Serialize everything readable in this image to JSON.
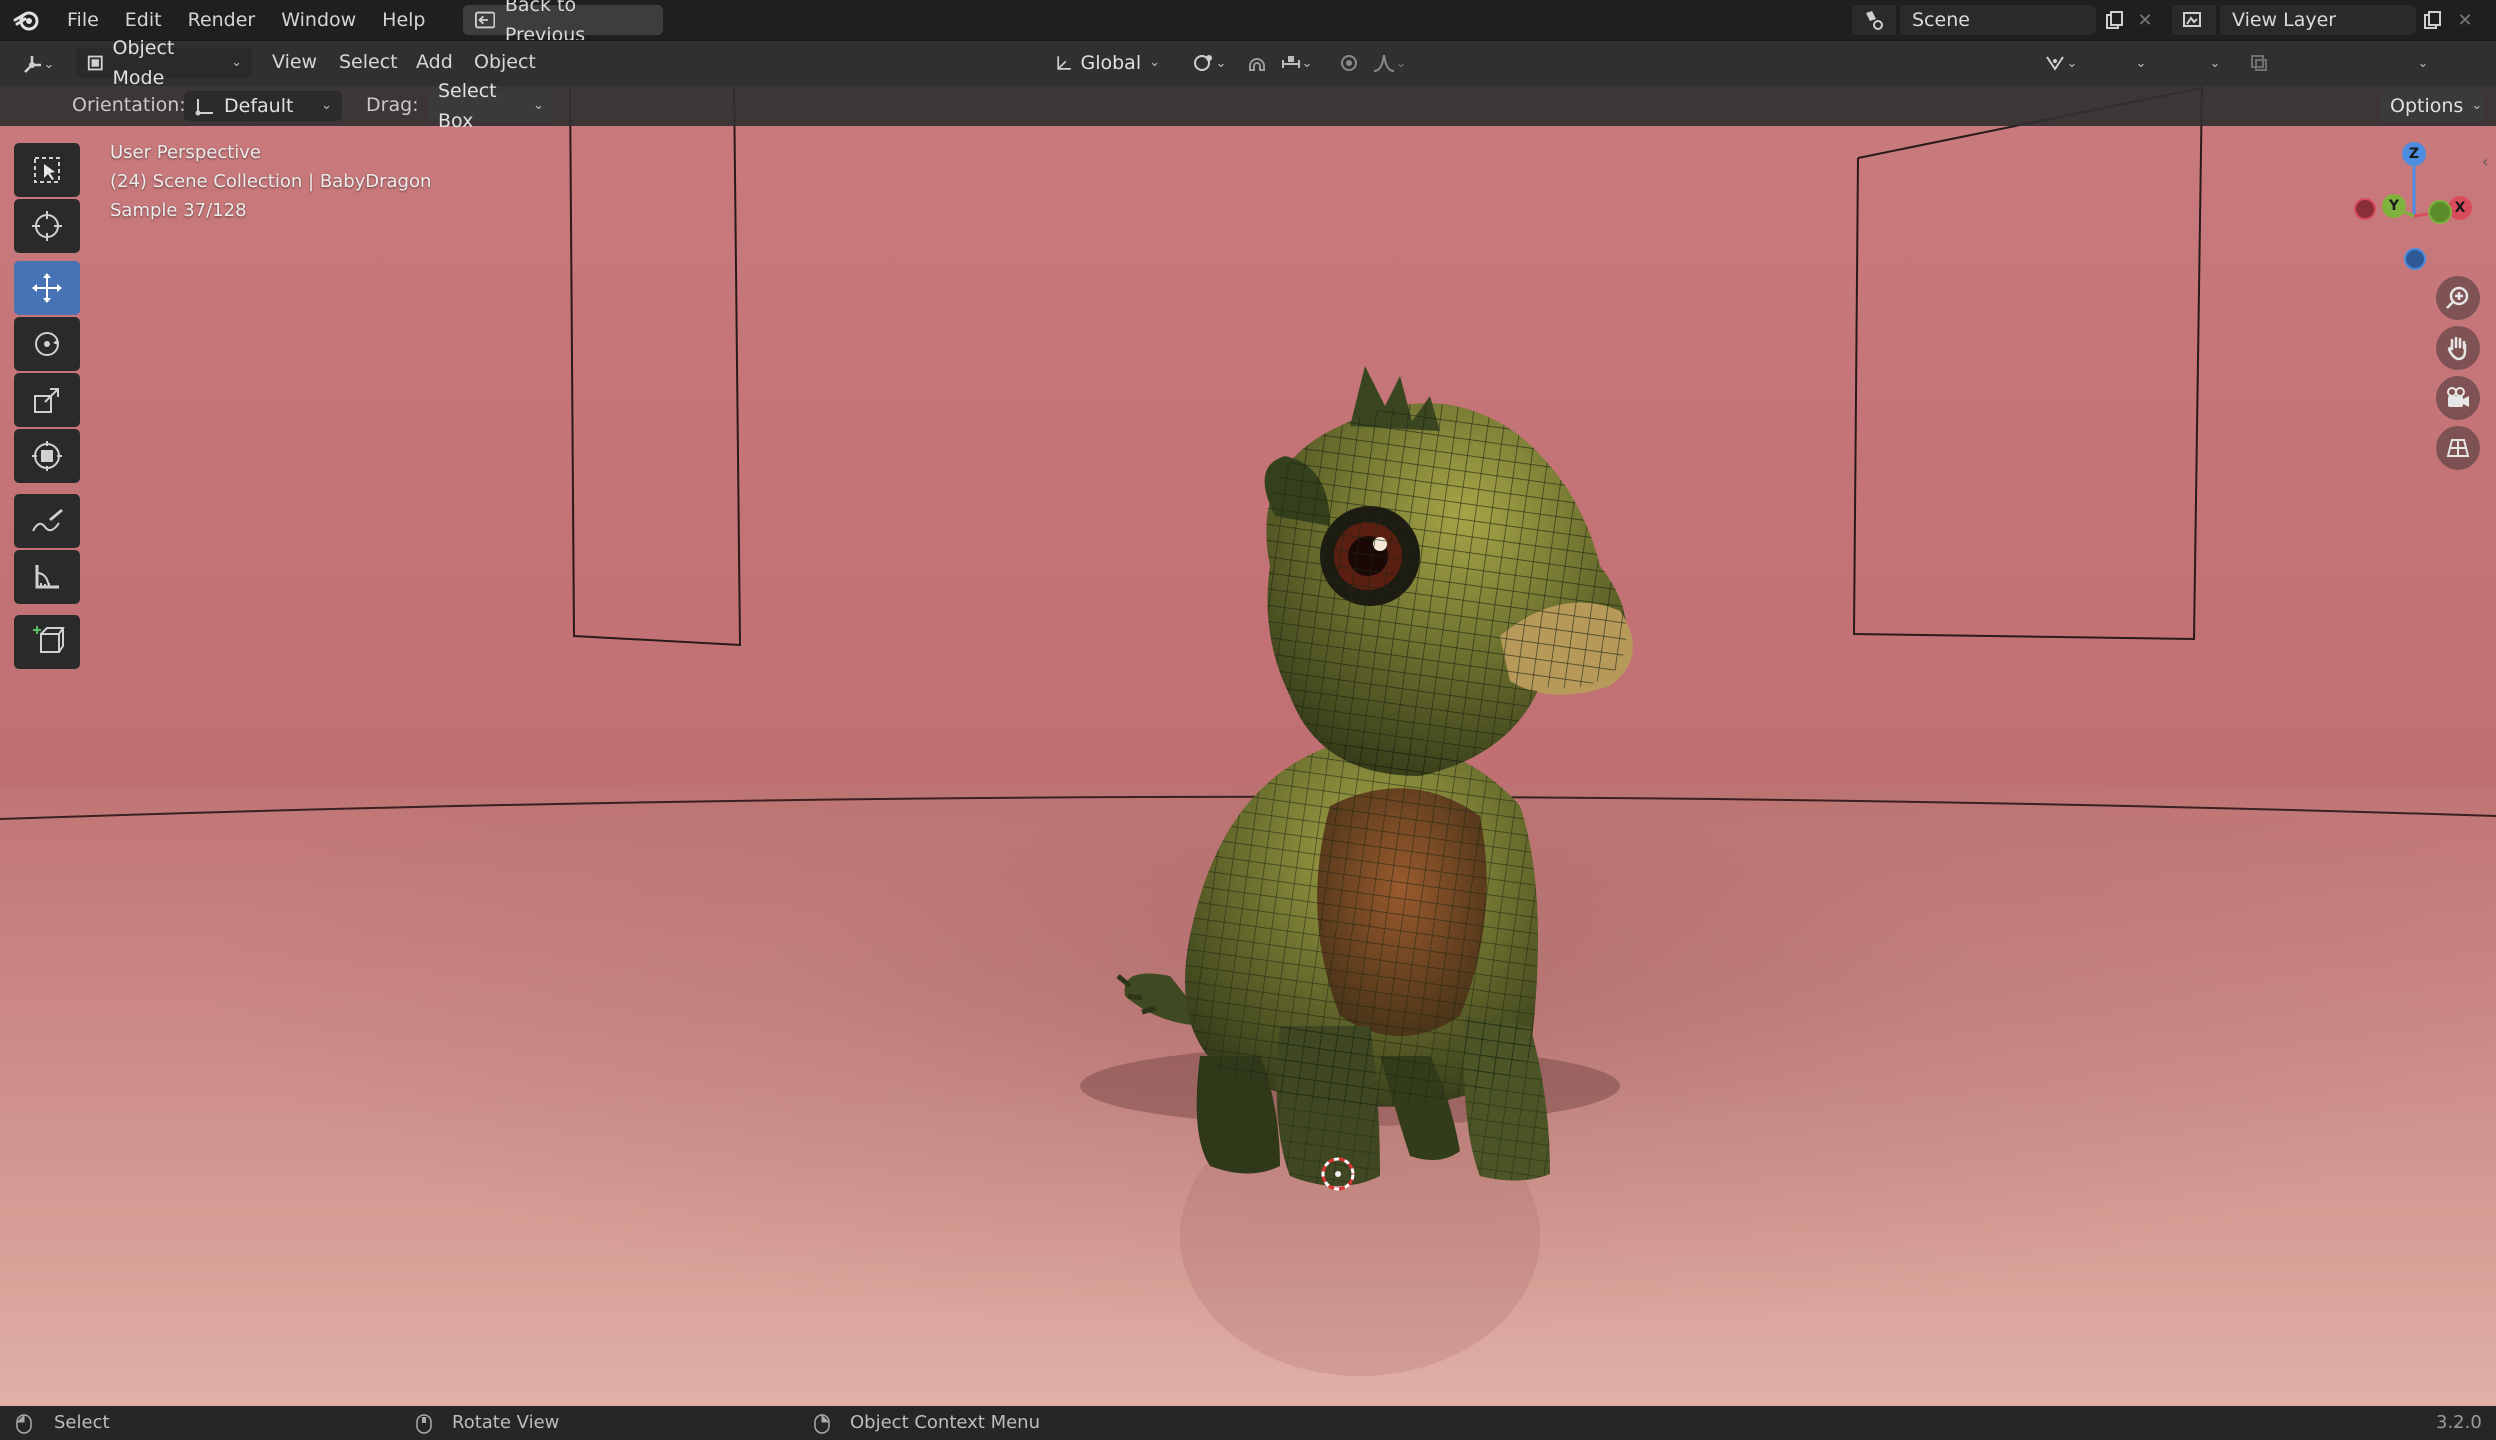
{
  "topbar": {
    "menus": [
      "File",
      "Edit",
      "Render",
      "Window",
      "Help"
    ],
    "back_button": "Back to Previous",
    "scene_label": "Scene",
    "view_layer_label": "View Layer"
  },
  "header": {
    "mode": "Object Mode",
    "menus": [
      "View",
      "Select",
      "Add",
      "Object"
    ],
    "transform_orientation": "Global"
  },
  "tool_settings": {
    "orientation_label": "Orientation:",
    "orientation_value": "Default",
    "drag_label": "Drag:",
    "drag_value": "Select Box",
    "options_label": "Options"
  },
  "viewport": {
    "view_name": "User Perspective",
    "collection_info": "(24) Scene Collection | BabyDragon",
    "sample_info": "Sample 37/128"
  },
  "tools": [
    {
      "name": "select-box-tool",
      "active": false
    },
    {
      "name": "cursor-tool",
      "active": false
    },
    {
      "name": "move-tool",
      "active": true
    },
    {
      "name": "rotate-tool",
      "active": false
    },
    {
      "name": "scale-tool",
      "active": false
    },
    {
      "name": "transform-tool",
      "active": false
    },
    {
      "name": "annotate-tool",
      "active": false
    },
    {
      "name": "measure-tool",
      "active": false
    },
    {
      "name": "add-cube-tool",
      "active": false
    }
  ],
  "gizmo": {
    "z": "Z",
    "y": "Y",
    "x": "X"
  },
  "statusbar": {
    "select": "Select",
    "rotate": "Rotate View",
    "context_menu": "Object Context Menu",
    "version": "3.2.0"
  },
  "colors": {
    "accent": "#4772b3",
    "axis_x": "#d94c5c",
    "axis_y": "#7fb33e",
    "axis_z": "#4d8ee0"
  }
}
